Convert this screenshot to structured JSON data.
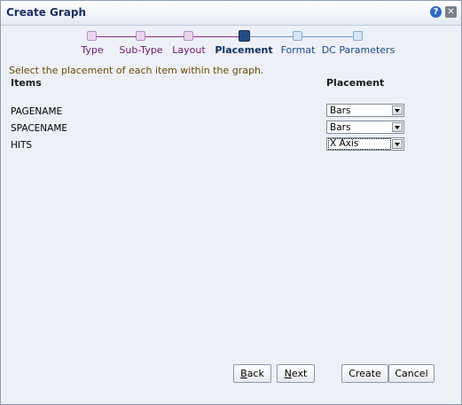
{
  "dialog": {
    "title": "Create Graph"
  },
  "train": {
    "steps": [
      {
        "label": "Type",
        "state": "visited"
      },
      {
        "label": "Sub-Type",
        "state": "visited"
      },
      {
        "label": "Layout",
        "state": "visited"
      },
      {
        "label": "Placement",
        "state": "current"
      },
      {
        "label": "Format",
        "state": "future"
      },
      {
        "label": "DC Parameters",
        "state": "future"
      }
    ]
  },
  "content": {
    "instruction": "Select the placement of each item within the graph.",
    "items_header": "Items",
    "placement_header": "Placement",
    "rows": [
      {
        "item": "PAGENAME",
        "placement": "Bars"
      },
      {
        "item": "SPACENAME",
        "placement": "Bars"
      },
      {
        "item": "HITS",
        "placement": "X Axis"
      }
    ]
  },
  "buttons": {
    "back": "Back",
    "next": "Next",
    "create": "Create",
    "cancel": "Cancel"
  }
}
